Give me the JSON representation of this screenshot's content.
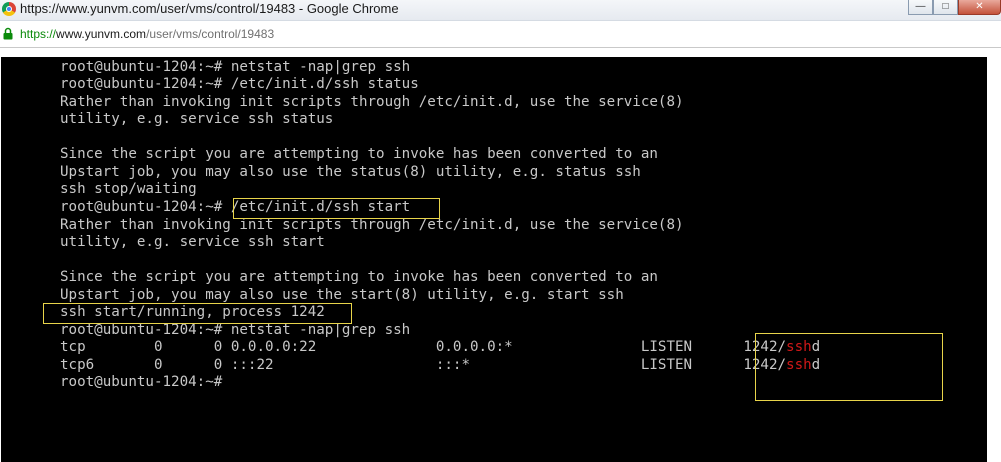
{
  "window": {
    "title": "https://www.yunvm.com/user/vms/control/19483 - Google Chrome",
    "controls": {
      "minimize": "—",
      "maximize": "□",
      "close": "✕"
    }
  },
  "address": {
    "scheme": "https://",
    "host": "www.yunvm.com",
    "path": "/user/vms/control/19483"
  },
  "terminal": {
    "lines": [
      "root@ubuntu-1204:~# netstat -nap|grep ssh",
      "root@ubuntu-1204:~# /etc/init.d/ssh status",
      "Rather than invoking init scripts through /etc/init.d, use the service(8)",
      "utility, e.g. service ssh status",
      "",
      "Since the script you are attempting to invoke has been converted to an",
      "Upstart job, you may also use the status(8) utility, e.g. status ssh",
      "ssh stop/waiting",
      "root@ubuntu-1204:~# /etc/init.d/ssh start",
      "Rather than invoking init scripts through /etc/init.d, use the service(8)",
      "utility, e.g. service ssh start",
      "",
      "Since the script you are attempting to invoke has been converted to an",
      "Upstart job, you may also use the start(8) utility, e.g. start ssh",
      "ssh start/running, process 1242",
      "root@ubuntu-1204:~# netstat -nap|grep ssh",
      "tcp        0      0 0.0.0.0:22              0.0.0.0:*               LISTEN      1242/",
      "tcp6       0      0 :::22                   :::*                    LISTEN      1242/",
      "root@ubuntu-1204:~#"
    ],
    "pid_highlight": {
      "prefix": "1242/",
      "highlight": "ssh",
      "suffix": "d"
    },
    "colors": {
      "background": "#000000",
      "text": "#c8c8c8",
      "box": "#e8d44a",
      "highlight": "#d01818"
    }
  }
}
